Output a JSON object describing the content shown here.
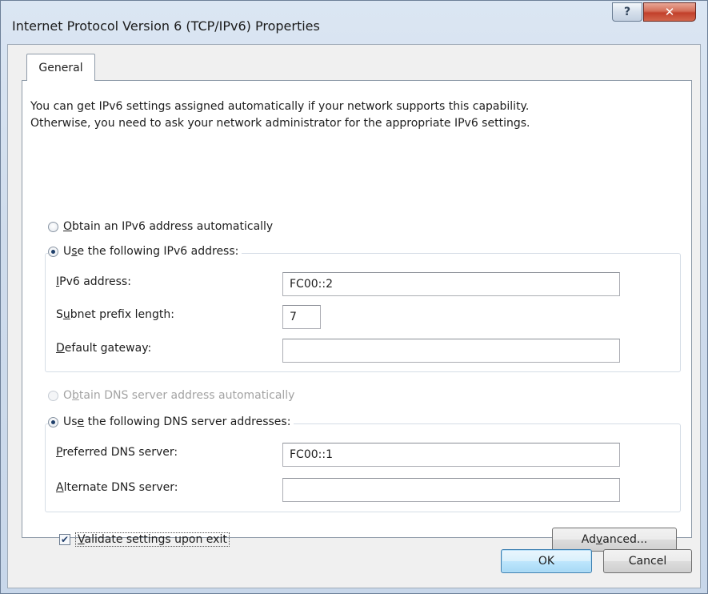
{
  "window": {
    "title": "Internet Protocol Version 6 (TCP/IPv6) Properties",
    "help_label": "?",
    "close_label": "✕"
  },
  "tabs": [
    {
      "label": "General",
      "selected": true
    }
  ],
  "description": "You can get IPv6 settings assigned automatically if your network supports this capability.\nOtherwise, you need to ask your network administrator for the appropriate IPv6 settings.",
  "ip_section": {
    "auto_option": {
      "pre": "",
      "accel": "O",
      "post": "btain an IPv6 address automatically",
      "checked": false
    },
    "manual_option": {
      "pre": "U",
      "accel": "s",
      "post": "e the following IPv6 address:",
      "checked": true
    },
    "fields": [
      {
        "pre": "",
        "accel": "I",
        "post": "Pv6 address:",
        "value": "FC00::2"
      },
      {
        "pre": "S",
        "accel": "u",
        "post": "bnet prefix length:",
        "value": "7"
      },
      {
        "pre": "",
        "accel": "D",
        "post": "efault gateway:",
        "value": ""
      }
    ]
  },
  "dns_section": {
    "auto_option": {
      "pre": "O",
      "accel": "b",
      "post": "tain DNS server address automatically",
      "checked": false,
      "disabled": true
    },
    "manual_option": {
      "pre": "Us",
      "accel": "e",
      "post": " the following DNS server addresses:",
      "checked": true
    },
    "fields": [
      {
        "pre": "",
        "accel": "P",
        "post": "referred DNS server:",
        "value": "FC00::1"
      },
      {
        "pre": "",
        "accel": "A",
        "post": "lternate DNS server:",
        "value": ""
      }
    ]
  },
  "validate": {
    "pre": "",
    "accel": "V",
    "post": "alidate settings upon exit",
    "checked": true,
    "check_glyph": "✔"
  },
  "buttons": {
    "advanced": {
      "pre": "Ad",
      "accel": "v",
      "post": "anced..."
    },
    "ok": "OK",
    "cancel": "Cancel"
  }
}
